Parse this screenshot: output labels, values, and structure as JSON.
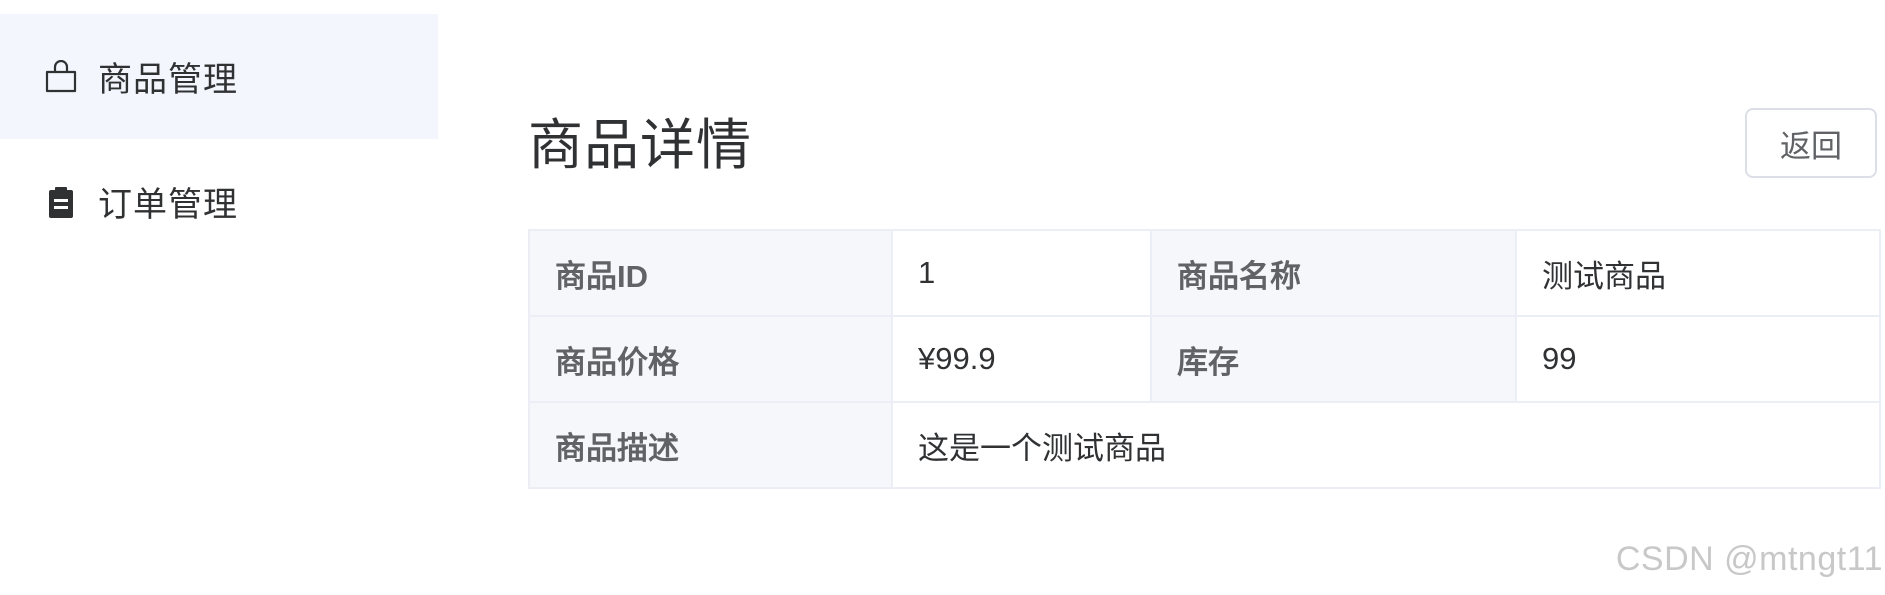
{
  "sidebar": {
    "items": [
      {
        "label": "商品管理",
        "icon": "shopping-bag-icon",
        "active": true
      },
      {
        "label": "订单管理",
        "icon": "clipboard-icon",
        "active": false
      }
    ]
  },
  "main": {
    "title": "商品详情",
    "back_label": "返回",
    "details": {
      "id_label": "商品ID",
      "id_value": "1",
      "name_label": "商品名称",
      "name_value": "测试商品",
      "price_label": "商品价格",
      "price_value": "¥99.9",
      "stock_label": "库存",
      "stock_value": "99",
      "desc_label": "商品描述",
      "desc_value": "这是一个测试商品"
    }
  },
  "watermark": "CSDN @mtngt11",
  "colors": {
    "active_menu_bg": "#f3f7fd",
    "label_cell_bg": "#f5f7fa",
    "border": "#ebeef5",
    "text": "#303133"
  }
}
